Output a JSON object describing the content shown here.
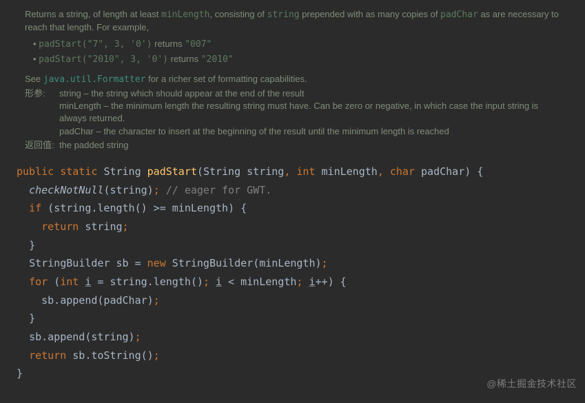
{
  "doc": {
    "desc_p1": "Returns a string, of length at least ",
    "desc_code1": "minLength",
    "desc_p2": ", consisting of ",
    "desc_code2": "string",
    "desc_p3": " prepended with as many copies of ",
    "desc_code3": "padChar",
    "desc_p4": " as are necessary to reach that length. For example,",
    "ex1_code": "padStart(\"7\", 3, '0')",
    "ex1_tail": " returns ",
    "ex1_result": "\"007\"",
    "ex2_code": "padStart(\"2010\", 3, '0')",
    "ex2_tail": " returns ",
    "ex2_result": "\"2010\"",
    "see_prefix": "See ",
    "see_link": "java.util.Formatter",
    "see_suffix": " for a richer set of formatting capabilities.",
    "params_label": "形参:",
    "param_string": "string – the string which should appear at the end of the result",
    "param_minLength": "minLength – the minimum length the resulting string must have. Can be zero or negative, in which case the input string is always returned.",
    "param_padChar": "padChar – the character to insert at the beginning of the result until the minimum length is reached",
    "return_label": "返回值:",
    "return_text": " the padded string"
  },
  "code": {
    "l1_public": "public",
    "l1_static": "static",
    "l1_String": "String",
    "l1_method": "padStart",
    "l1_open": "(",
    "l1_p1t": "String",
    "l1_p1n": "string",
    "l1_int": "int",
    "l1_p2n": "minLength",
    "l1_char": "char",
    "l1_p3n": "padChar",
    "l1_close": ")",
    "l1_brace": "{",
    "l2_call": "checkNotNull",
    "l2_arg": "string",
    "l2_comment": "// eager for GWT.",
    "l3_if": "if",
    "l3_cond_open": "(",
    "l3_expr1": "string.length()",
    "l3_op": " >= ",
    "l3_expr2": "minLength",
    "l3_cond_close": ")",
    "l3_brace": "{",
    "l4_return": "return",
    "l4_val": "string",
    "l5_brace": "}",
    "l6_type": "StringBuilder",
    "l6_var": "sb",
    "l6_eq": " = ",
    "l6_new": "new",
    "l6_ctor": "StringBuilder",
    "l6_arg": "minLength",
    "l7_for": "for",
    "l7_int": "int",
    "l7_i": "i",
    "l7_init": " = string.length()",
    "l7_cond": " < minLength",
    "l7_inc": "++",
    "l7_brace": "{",
    "l8": "sb.append(padChar)",
    "l9_brace": "}",
    "l10": "sb.append(string)",
    "l11_return": "return",
    "l11_expr": "sb.toString()",
    "l12_brace": "}"
  },
  "watermark": "@稀土掘金技术社区"
}
